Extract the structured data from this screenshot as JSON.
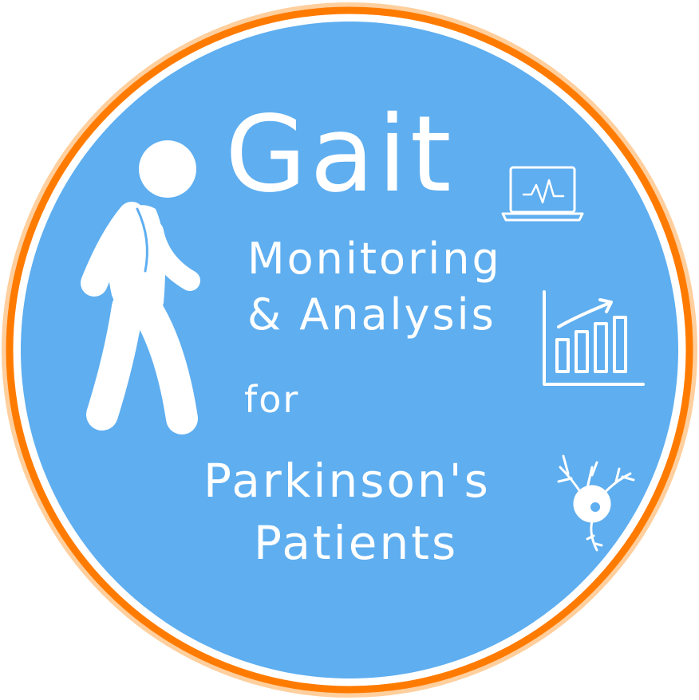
{
  "logo": {
    "title": "Gait",
    "line1": "Monitoring",
    "line2": "& Analysis",
    "connector": "for",
    "line3": "Parkinson's",
    "line4": "Patients"
  },
  "colors": {
    "circle_fill": "#5eaef0",
    "ring_outer": "#ff7b00",
    "ring_inner": "#ffb870",
    "foreground": "#ffffff"
  },
  "icons": [
    "walking-person-icon",
    "laptop-heartbeat-icon",
    "bar-chart-trend-icon",
    "neuron-icon"
  ]
}
